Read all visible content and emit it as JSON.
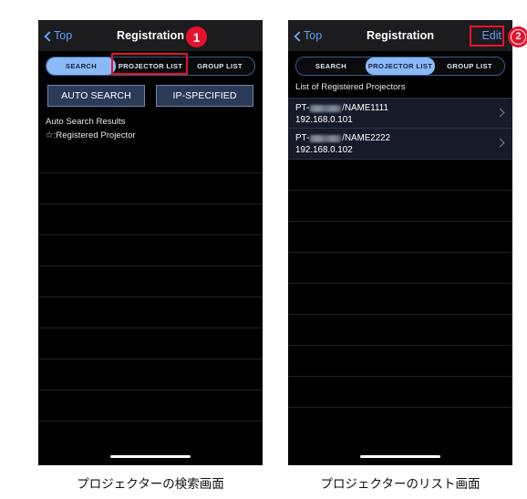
{
  "screens": {
    "left": {
      "nav": {
        "back_label": "Top",
        "back_icon": "chevron-left-icon",
        "title": "Registration"
      },
      "segments": [
        {
          "label": "SEARCH",
          "selected": true
        },
        {
          "label": "PROJECTOR LIST",
          "selected": false
        },
        {
          "label": "GROUP LIST",
          "selected": false
        }
      ],
      "buttons": [
        {
          "label": "AUTO SEARCH"
        },
        {
          "label": "IP-SPECIFIED"
        }
      ],
      "info_lines": [
        "Auto Search Results",
        "☆:Registered Projector"
      ],
      "empty_row_count": 9,
      "caption": "プロジェクターの検索画面"
    },
    "right": {
      "nav": {
        "back_label": "Top",
        "back_icon": "chevron-left-icon",
        "title": "Registration",
        "edit_label": "Edit"
      },
      "segments": [
        {
          "label": "SEARCH",
          "selected": false
        },
        {
          "label": "PROJECTOR LIST",
          "selected": true
        },
        {
          "label": "GROUP LIST",
          "selected": false
        }
      ],
      "list_header": "List of Registered Projectors",
      "rows": [
        {
          "prefix": "PT-",
          "model_redacted": true,
          "name": "/NAME1111",
          "ip": "192.168.0.101",
          "chevron": "chevron-right-icon"
        },
        {
          "prefix": "PT-",
          "model_redacted": true,
          "name": "/NAME2222",
          "ip": "192.168.0.102",
          "chevron": "chevron-right-icon"
        }
      ],
      "empty_row_count": 8,
      "caption": "プロジェクターのリスト画面"
    }
  },
  "annotations": {
    "badges": [
      {
        "number": "1",
        "style": "filled"
      },
      {
        "number": "2",
        "style": "outline"
      }
    ],
    "highlight_color": "#e8112d",
    "highlights": [
      {
        "target": "projector-list-tab-left"
      },
      {
        "target": "edit-button-right"
      }
    ]
  },
  "colors": {
    "accent_blue": "#5ea0f2",
    "segment_selected": "#8bb9f7",
    "action_button": "#2b3a57",
    "row_background": "#151b28",
    "annotation_red": "#e8112d"
  }
}
